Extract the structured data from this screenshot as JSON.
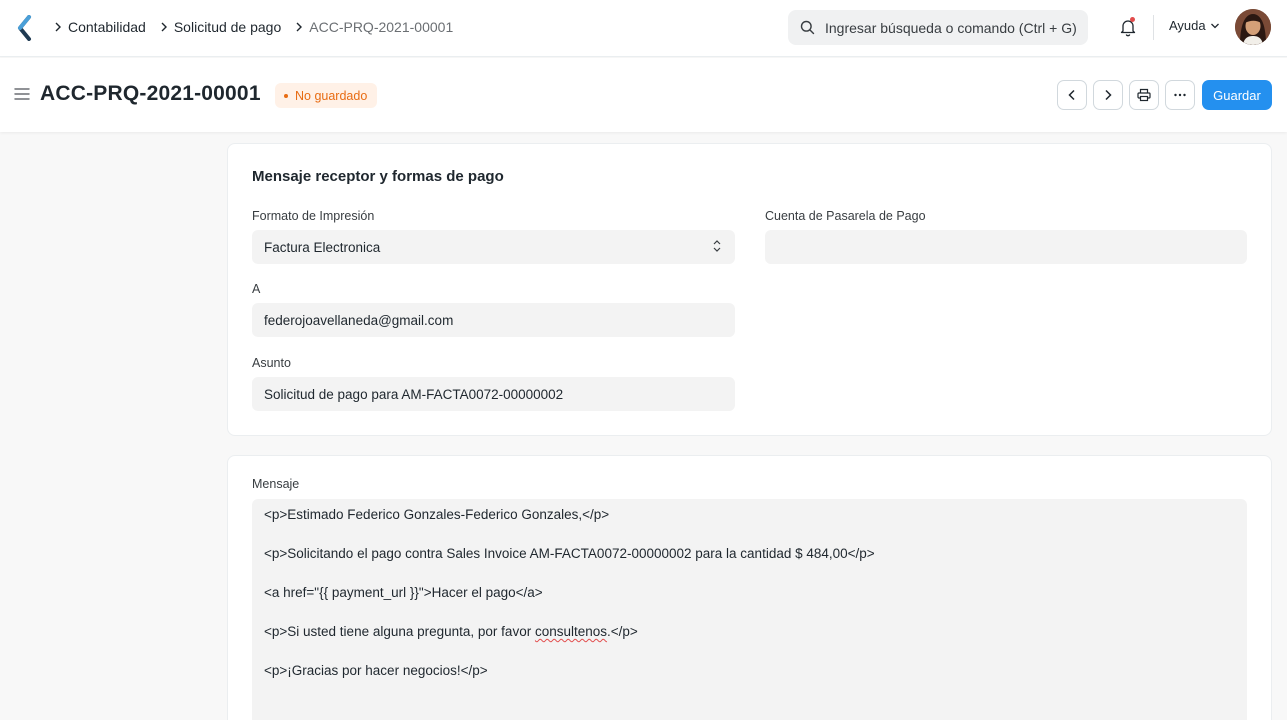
{
  "breadcrumbs": [
    "Contabilidad",
    "Solicitud de pago",
    "ACC-PRQ-2021-00001"
  ],
  "search": {
    "placeholder": "Ingresar búsqueda o comando (Ctrl + G)"
  },
  "navbar": {
    "help_label": "Ayuda"
  },
  "header": {
    "title": "ACC-PRQ-2021-00001",
    "status_badge": "No guardado",
    "save_label": "Guardar"
  },
  "section1": {
    "title": "Mensaje receptor y formas de pago",
    "print_format": {
      "label": "Formato de Impresión",
      "value": "Factura Electronica"
    },
    "payment_gateway_account": {
      "label": "Cuenta de Pasarela de Pago",
      "value": ""
    },
    "to": {
      "label": "A",
      "value": "federojoavellaneda@gmail.com"
    },
    "subject": {
      "label": "Asunto",
      "value": "Solicitud de pago para AM-FACTA0072-00000002"
    }
  },
  "message": {
    "label": "Mensaje",
    "lines": [
      "<p>Estimado Federico Gonzales-Federico Gonzales,</p>",
      "<p>Solicitando el pago contra Sales Invoice AM-FACTA0072-00000002 para la cantidad $ 484,00</p>",
      "<a href=\"{{ payment_url }}\">Hacer el pago</a>",
      "<p>Si usted tiene alguna pregunta, por favor ",
      "consultenos",
      ".</p>",
      "<p>¡Gracias por hacer negocios!</p>"
    ]
  },
  "colors": {
    "primary": "#2490ef",
    "badge_text": "#e86c13",
    "badge_bg": "#fff1e7",
    "background": "#f8f8f8"
  },
  "icons": {
    "logo": "frappe-logo",
    "search": "search-icon",
    "notifications": "bell-icon",
    "help_dropdown": "chevron-down-icon",
    "menu": "hamburger-icon",
    "prev": "chevron-left-icon",
    "next": "chevron-right-icon",
    "print": "printer-icon",
    "more": "ellipsis-icon"
  }
}
